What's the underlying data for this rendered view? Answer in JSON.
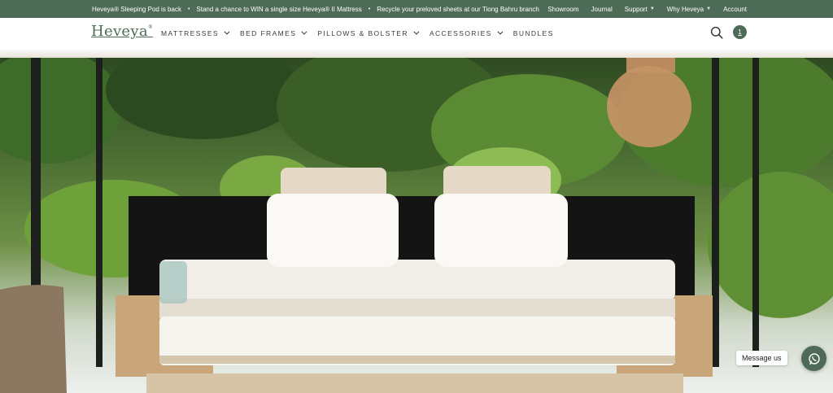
{
  "announcements": [
    "Heveya® Sleeping Pod is back",
    "Stand a chance to WIN a single size Heveya® II Mattress",
    "Recycle your preloved sheets at our Tiong Bahru branch"
  ],
  "utility_nav": {
    "showroom": "Showroom",
    "journal": "Journal",
    "support": "Support",
    "why_heveya": "Why Heveya",
    "account": "Account"
  },
  "logo": {
    "text": "Heveya",
    "mark": "®"
  },
  "main_nav": {
    "mattresses": "MATTRESSES",
    "bed_frames": "BED FRAMES",
    "pillows_bolster": "PILLOWS & BOLSTER",
    "accessories": "ACCESSORIES",
    "bundles": "BUNDLES"
  },
  "cart": {
    "count": "1"
  },
  "chat": {
    "label": "Message us"
  },
  "icons": {
    "search": "search-icon",
    "cart": "cart-icon",
    "chevron": "chevron-down-icon",
    "whatsapp": "whatsapp-icon"
  },
  "colors": {
    "brand_green": "#4d6b56",
    "white": "#ffffff"
  }
}
